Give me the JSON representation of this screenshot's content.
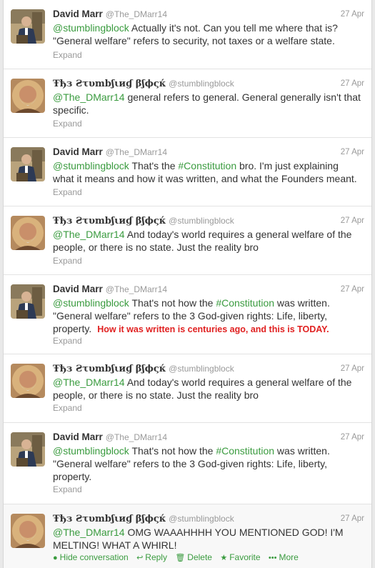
{
  "tweets": [
    {
      "author": "David Marr",
      "handle": "@The_DMarr14",
      "date": "27 Apr",
      "mention": "@stumblingblock",
      "text_a": " Actually it's not. Can you tell me where that is? \"General welfare\" refers to security, not taxes or a welfare state.",
      "expand": "Expand"
    },
    {
      "author": "Ŧђз Ƨτυmbʃιиɠ βʃϕςќ",
      "handle": "@stumblingblock",
      "date": "27 Apr",
      "mention": "@The_DMarr14",
      "text_a": " general refers to general. General generally isn't that specific.",
      "expand": "Expand"
    },
    {
      "author": "David Marr",
      "handle": "@The_DMarr14",
      "date": "27 Apr",
      "mention": "@stumblingblock",
      "text_a": " That's the ",
      "hashtag": "#Constitution",
      "text_b": " bro. I'm just explaining what it means and how it was written, and what the Founders meant.",
      "expand": "Expand"
    },
    {
      "author": "Ŧђз Ƨτυmbʃιиɠ βʃϕςќ",
      "handle": "@stumblingblock",
      "date": "27 Apr",
      "mention": "@The_DMarr14",
      "text_a": " And today's world requires a general welfare of the people, or there is no state. Just the reality bro",
      "expand": "Expand"
    },
    {
      "author": "David Marr",
      "handle": "@The_DMarr14",
      "date": "27 Apr",
      "mention": "@stumblingblock",
      "text_a": " That's not how the ",
      "hashtag": "#Constitution",
      "text_b": " was written. \"General welfare\" refers to the 3 God-given rights: Life, liberty, property.",
      "annotation": "How it was written is centuries ago, and this is TODAY.",
      "expand": "Expand"
    },
    {
      "author": "Ŧђз Ƨτυmbʃιиɠ βʃϕςќ",
      "handle": "@stumblingblock",
      "date": "27 Apr",
      "mention": "@The_DMarr14",
      "text_a": " And today's world requires a general welfare of the people, or there is no state. Just the reality bro",
      "expand": "Expand"
    },
    {
      "author": "David Marr",
      "handle": "@The_DMarr14",
      "date": "27 Apr",
      "mention": "@stumblingblock",
      "text_a": " That's not how the ",
      "hashtag": "#Constitution",
      "text_b": " was written. \"General welfare\" refers to the 3 God-given rights: Life, liberty, property.",
      "expand": "Expand"
    },
    {
      "author": "Ŧђз Ƨτυmbʃιиɠ βʃϕςќ",
      "handle": "@stumblingblock",
      "date": "27 Apr",
      "mention": "@The_DMarr14",
      "text_a": " OMG WAAAHHHH YOU MENTIONED GOD! I'M MELTING! WHAT A WHIRL!"
    }
  ],
  "actions": {
    "hide": "Hide conversation",
    "reply": "Reply",
    "delete": "Delete",
    "favorite": "Favorite",
    "more": "More"
  },
  "icons": {
    "hide": "speech-bubble-icon",
    "reply": "reply-arrow-icon",
    "delete": "trash-icon",
    "favorite": "star-icon",
    "more": "more-dots-icon"
  },
  "colors": {
    "link": "#3a9b3f",
    "annotation": "#e02020",
    "name": "#333333",
    "muted": "#999999"
  }
}
